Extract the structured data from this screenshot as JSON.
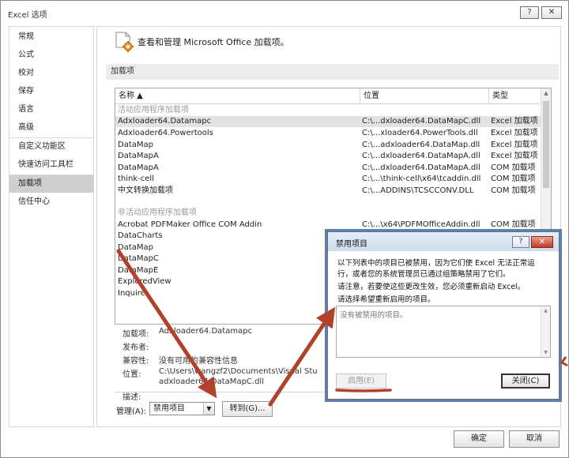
{
  "window": {
    "title": "Excel 选项",
    "help_glyph": "?",
    "close_glyph": "✕"
  },
  "nav": {
    "items": [
      "常规",
      "公式",
      "校对",
      "保存",
      "语言",
      "高级",
      "自定义功能区",
      "快速访问工具栏",
      "加载项",
      "信任中心"
    ],
    "active_index": 8
  },
  "main": {
    "header": "查看和管理 Microsoft Office 加载项。",
    "section_title": "加载项"
  },
  "addins": {
    "columns": [
      "名称 ▲",
      "位置",
      "类型"
    ],
    "groups": [
      "活动应用程序加载项",
      "非活动应用程序加载项"
    ],
    "active": [
      {
        "name": "Adxloader64.Datamapc",
        "location": "C:\\...dxloader64.DataMapC.dll",
        "type": "Excel 加载项"
      },
      {
        "name": "Adxloader64.Powertools",
        "location": "C:\\...xloader64.PowerTools.dll",
        "type": "Excel 加载项"
      },
      {
        "name": "DataMap",
        "location": "C:\\...adxloader64.DataMap.dll",
        "type": "Excel 加载项"
      },
      {
        "name": "DataMapA",
        "location": "C:\\...dxloader64.DataMapA.dll",
        "type": "Excel 加载项"
      },
      {
        "name": "DataMapA",
        "location": "C:\\...dxloader64.DataMapA.dll",
        "type": "COM 加载项"
      },
      {
        "name": "think-cell",
        "location": "C:\\...\\think-cell\\x64\\tcaddin.dll",
        "type": "COM 加载项"
      },
      {
        "name": "中文转换加载项",
        "location": "C:\\...ADDINS\\TCSCCONV.DLL",
        "type": "COM 加载项"
      }
    ],
    "inactive": [
      {
        "name": "Acrobat PDFMaker Office COM Addin",
        "location": "C:\\...\\x64\\PDFMOfficeAddin.dll",
        "type": "COM 加载项"
      },
      {
        "name": "DataCharts",
        "location": "",
        "type": ""
      },
      {
        "name": "DataMap",
        "location": "",
        "type": ""
      },
      {
        "name": "DataMapC",
        "location": "",
        "type": ""
      },
      {
        "name": "DataMapE",
        "location": "",
        "type": ""
      },
      {
        "name": "ExploredView",
        "location": "",
        "type": ""
      },
      {
        "name": "Inquire",
        "location": "",
        "type": ""
      }
    ]
  },
  "details": {
    "addin_label": "加载项:",
    "addin_value": "Adxloader64.Datamapc",
    "publisher_label": "发布者:",
    "publisher_value": "",
    "compat_label": "兼容性:",
    "compat_value": "没有可用的兼容性信息",
    "location_label": "位置:",
    "location_value_line1": "C:\\Users\\wangzf2\\Documents\\Visual Stu",
    "location_value_line2": "adxloader64.DataMapC.dll",
    "desc_label": "描述:"
  },
  "manage": {
    "label": "管理(A):",
    "selected": "禁用项目",
    "goto_label": "转到(G)..."
  },
  "footer": {
    "ok": "确定",
    "cancel": "取消"
  },
  "dialog": {
    "title": "禁用项目",
    "help_glyph": "?",
    "close_glyph": "✕",
    "line1": "以下列表中的项目已被禁用，因为它们使 Excel 无法正常运",
    "line2": "行，或者您的系统管理员已通过组策略禁用了它们。",
    "line3": "请注意，若要使这些更改生效，您必须重新启动 Excel。",
    "line4": "请选择希望重新启用的项目。",
    "empty_text": "没有被禁用的项目。",
    "enable_label": "启用(E)",
    "close_label": "关闭(C)"
  },
  "colors": {
    "arrow": "#b2412c",
    "nav_active": "#cfcfcf",
    "selected_row": "#e3e3e3"
  }
}
